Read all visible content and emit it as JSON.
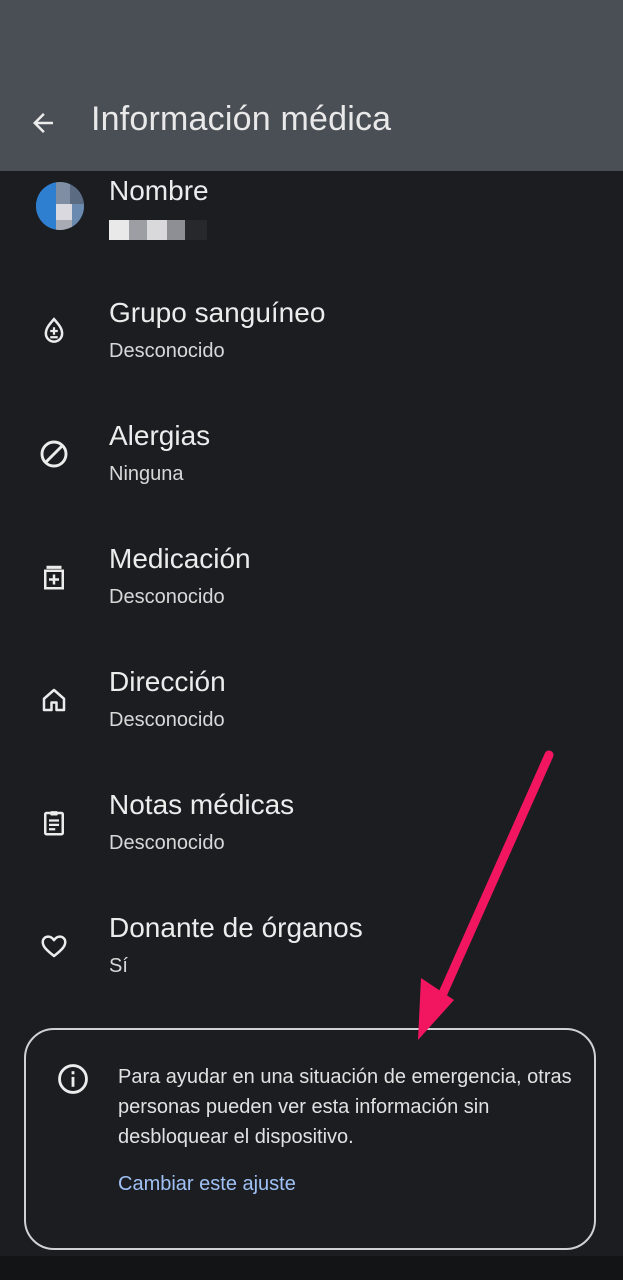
{
  "header": {
    "title": "Información médica",
    "back_icon": "arrow-back-icon"
  },
  "items": [
    {
      "title": "Nombre",
      "subtitle": "",
      "icon": "avatar"
    },
    {
      "title": "Grupo sanguíneo",
      "subtitle": "Desconocido",
      "icon": "blood-drop-icon"
    },
    {
      "title": "Alergias",
      "subtitle": "Ninguna",
      "icon": "block-icon"
    },
    {
      "title": "Medicación",
      "subtitle": "Desconocido",
      "icon": "medication-icon"
    },
    {
      "title": "Dirección",
      "subtitle": "Desconocido",
      "icon": "home-icon"
    },
    {
      "title": "Notas médicas",
      "subtitle": "Desconocido",
      "icon": "clipboard-icon"
    },
    {
      "title": "Donante de órganos",
      "subtitle": "Sí",
      "icon": "heart-icon"
    }
  ],
  "notice": {
    "text": "Para ayudar en una situación de emergencia, otras personas pueden ver esta información sin desbloquear el dispositivo.",
    "link": "Cambiar este ajuste",
    "icon": "info-icon"
  },
  "colors": {
    "appbar": "#4a4f55",
    "background": "#1b1d21",
    "link": "#9fc1f5",
    "annotation_arrow": "#f2155f"
  }
}
